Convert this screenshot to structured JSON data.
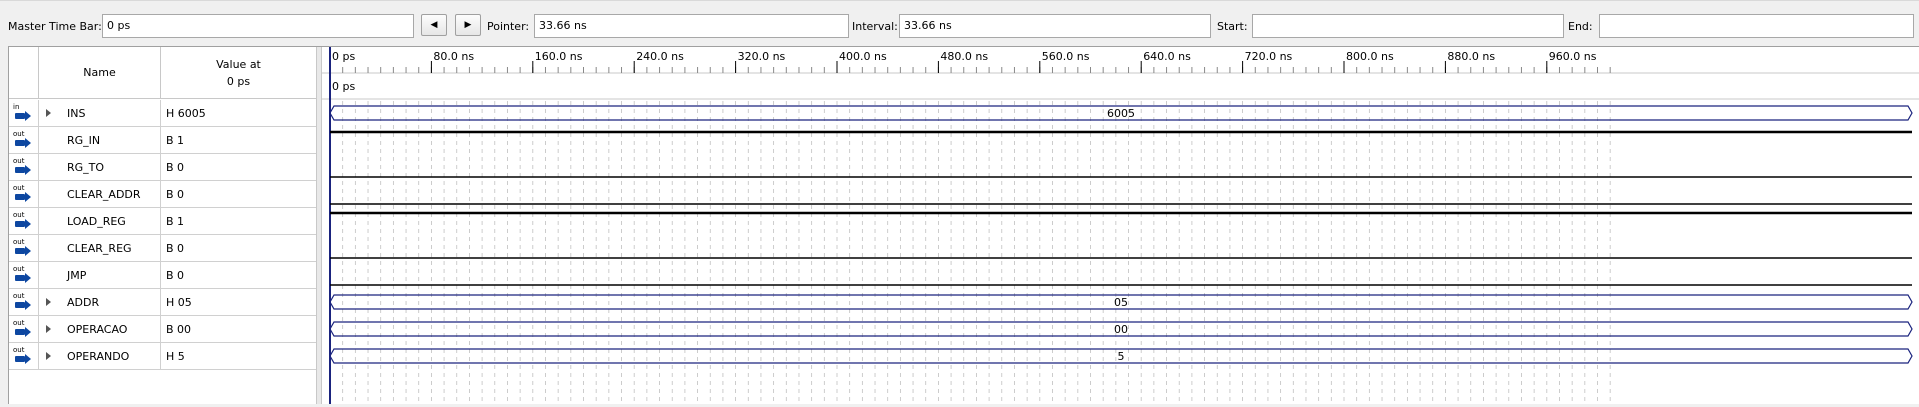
{
  "toolbar": {
    "master_label": "Master Time Bar:",
    "master_value": "0 ps",
    "pointer_label": "Pointer:",
    "pointer_value": "33.66 ns",
    "interval_label": "Interval:",
    "interval_value": "33.66 ns",
    "start_label": "Start:",
    "start_value": "",
    "end_label": "End:",
    "end_value": ""
  },
  "header": {
    "name_col": "Name",
    "value_col_line1": "Value at",
    "value_col_line2": "0 ps",
    "cursor_label": "0 ps"
  },
  "time_axis": {
    "ticks": [
      "0 ps",
      "80.0 ns",
      "160.0 ns",
      "240.0 ns",
      "320.0 ns",
      "400.0 ns",
      "480.0 ns",
      "560.0 ns",
      "640.0 ns",
      "720.0 ns",
      "800.0 ns",
      "880.0 ns",
      "960.0 ns"
    ]
  },
  "signals": [
    {
      "dir": "in",
      "name": "INS",
      "value": "H 6005",
      "bus": true,
      "bus_label": "6005",
      "level": null
    },
    {
      "dir": "out",
      "name": "RG_IN",
      "value": "B 1",
      "bus": false,
      "level": 1
    },
    {
      "dir": "out",
      "name": "RG_TO",
      "value": "B 0",
      "bus": false,
      "level": 0
    },
    {
      "dir": "out",
      "name": "CLEAR_ADDR",
      "value": "B 0",
      "bus": false,
      "level": 0
    },
    {
      "dir": "out",
      "name": "LOAD_REG",
      "value": "B 1",
      "bus": false,
      "level": 1
    },
    {
      "dir": "out",
      "name": "CLEAR_REG",
      "value": "B 0",
      "bus": false,
      "level": 0
    },
    {
      "dir": "out",
      "name": "JMP",
      "value": "B 0",
      "bus": false,
      "level": 0
    },
    {
      "dir": "out",
      "name": "ADDR",
      "value": "H 05",
      "bus": true,
      "bus_label": "05",
      "level": null
    },
    {
      "dir": "out",
      "name": "OPERACAO",
      "value": "B 00",
      "bus": true,
      "bus_label": "00",
      "level": null
    },
    {
      "dir": "out",
      "name": "OPERANDO",
      "value": "H 5",
      "bus": true,
      "bus_label": "5",
      "level": null
    }
  ],
  "colors": {
    "bus_outline": "#1a237e",
    "signal_line": "#000000",
    "grid_dash": "#c0c0c0",
    "cursor": "#1a237e",
    "icon_blue": "#0d47a1"
  }
}
